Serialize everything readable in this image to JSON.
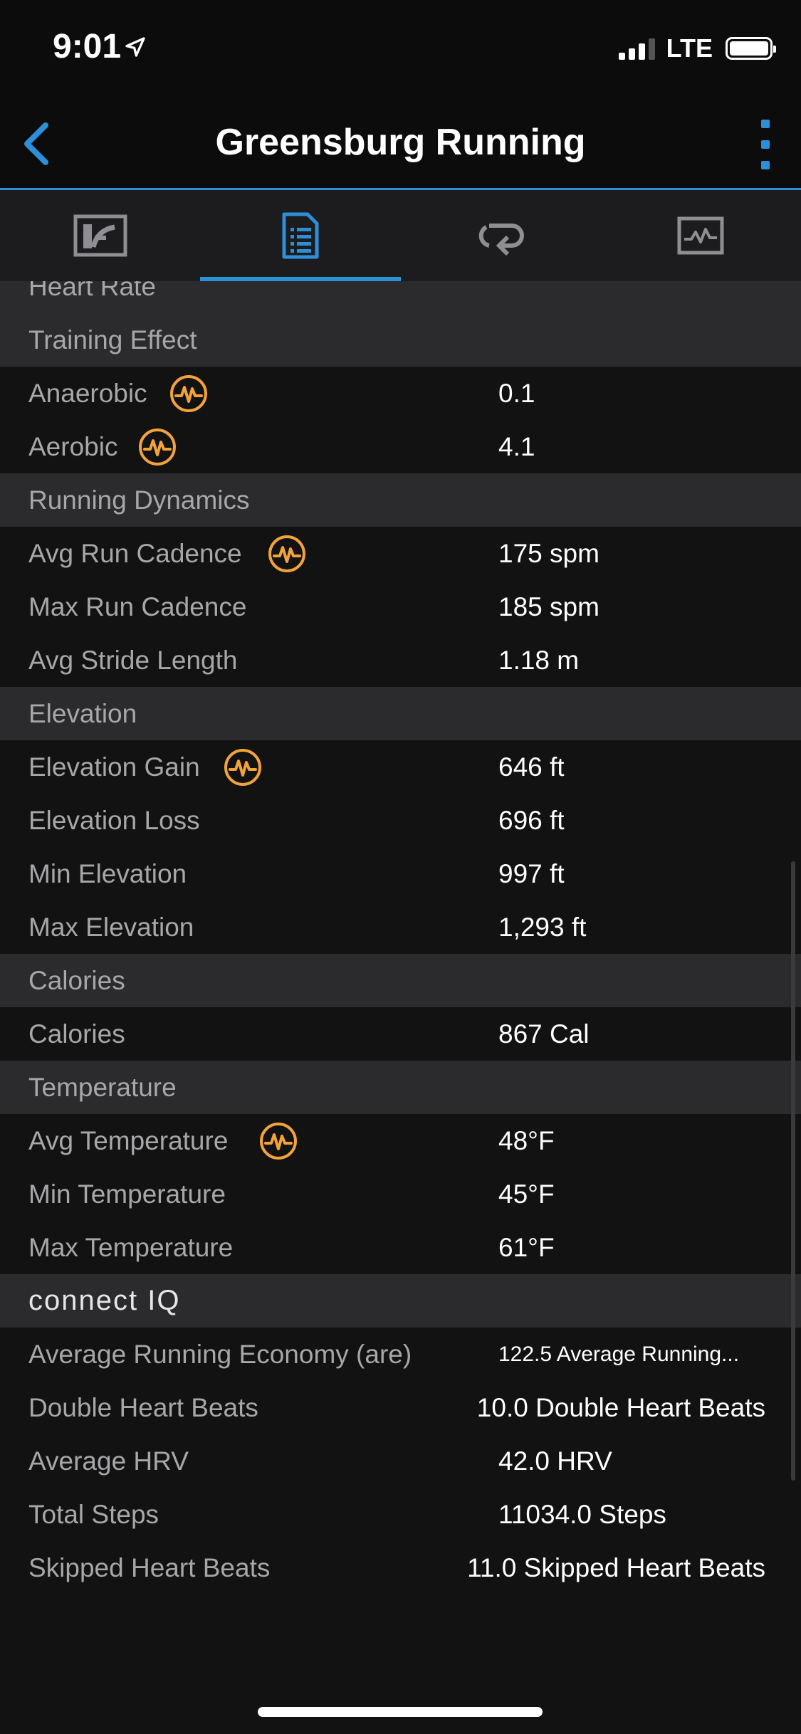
{
  "status": {
    "time": "9:01",
    "network": "LTE"
  },
  "nav": {
    "title": "Greensburg Running"
  },
  "tabs": [
    {
      "name": "stats-tab-icon"
    },
    {
      "name": "details-tab-icon",
      "active": true
    },
    {
      "name": "laps-tab-icon"
    },
    {
      "name": "charts-tab-icon"
    }
  ],
  "colors": {
    "accent": "#2c8fd8",
    "badge": "#f2a33a",
    "section_bg": "#2b2b2d",
    "background": "#121213"
  },
  "rows": {
    "heart_rate_header": "Heart Rate",
    "training_effect_header": "Training Effect",
    "anaerobic": {
      "label": "Anaerobic",
      "value": "0.1"
    },
    "aerobic": {
      "label": "Aerobic",
      "value": "4.1"
    },
    "running_dynamics_header": "Running Dynamics",
    "avg_run_cadence": {
      "label": "Avg Run Cadence",
      "value": "175 spm"
    },
    "max_run_cadence": {
      "label": "Max Run Cadence",
      "value": "185 spm"
    },
    "avg_stride_length": {
      "label": "Avg Stride Length",
      "value": "1.18 m"
    },
    "elevation_header": "Elevation",
    "elevation_gain": {
      "label": "Elevation Gain",
      "value": "646 ft"
    },
    "elevation_loss": {
      "label": "Elevation Loss",
      "value": "696 ft"
    },
    "min_elevation": {
      "label": "Min Elevation",
      "value": "997 ft"
    },
    "max_elevation": {
      "label": "Max Elevation",
      "value": "1,293 ft"
    },
    "calories_header": "Calories",
    "calories": {
      "label": "Calories",
      "value": "867 Cal"
    },
    "temperature_header": "Temperature",
    "avg_temperature": {
      "label": "Avg Temperature",
      "value": "48°F"
    },
    "min_temperature": {
      "label": "Min Temperature",
      "value": "45°F"
    },
    "max_temperature": {
      "label": "Max Temperature",
      "value": "61°F"
    },
    "connect_iq_header": "connect IQ",
    "avg_running_economy": {
      "label": "Average Running Economy (are)",
      "value": "122.5 Average Running..."
    },
    "double_heart_beats": {
      "label": "Double Heart Beats",
      "value": "10.0 Double Heart Beats"
    },
    "average_hrv": {
      "label": "Average HRV",
      "value": "42.0 HRV"
    },
    "total_steps": {
      "label": "Total Steps",
      "value": "11034.0 Steps"
    },
    "skipped_heart_beats": {
      "label": "Skipped Heart Beats",
      "value": "11.0 Skipped Heart Beats"
    }
  }
}
